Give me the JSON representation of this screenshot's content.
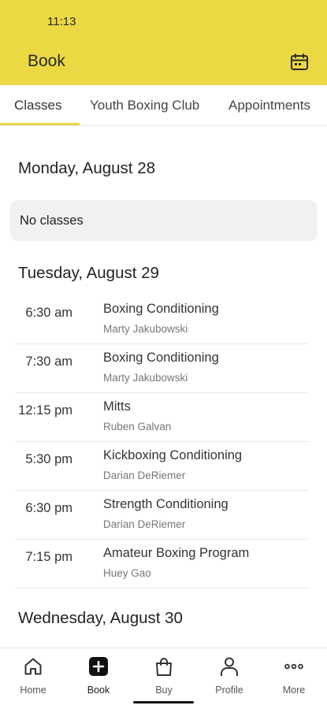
{
  "status_bar": {
    "time": "11:13"
  },
  "header": {
    "title": "Book",
    "calendar_icon": "calendar-icon",
    "background": "#ebd843"
  },
  "tabs": [
    {
      "label": "Classes",
      "active": true
    },
    {
      "label": "Youth Boxing Club",
      "active": false
    },
    {
      "label": "Appointments",
      "active": false
    }
  ],
  "days": [
    {
      "heading": "Monday, August 28",
      "empty_text": "No classes"
    },
    {
      "heading": "Tuesday, August 29",
      "classes": [
        {
          "time": "6:30 am",
          "name": "Boxing Conditioning",
          "instructor": "Marty Jakubowski"
        },
        {
          "time": "7:30 am",
          "name": "Boxing Conditioning",
          "instructor": "Marty Jakubowski"
        },
        {
          "time": "12:15 pm",
          "name": "Mitts",
          "instructor": "Ruben Galvan"
        },
        {
          "time": "5:30 pm",
          "name": "Kickboxing Conditioning",
          "instructor": "Darian DeRiemer"
        },
        {
          "time": "6:30 pm",
          "name": "Strength Conditioning",
          "instructor": "Darian DeRiemer"
        },
        {
          "time": "7:15 pm",
          "name": "Amateur Boxing Program",
          "instructor": "Huey Gao"
        }
      ]
    },
    {
      "heading": "Wednesday, August 30"
    }
  ],
  "bottom_nav": [
    {
      "label": "Home",
      "icon": "home-icon"
    },
    {
      "label": "Book",
      "icon": "plus-square-icon"
    },
    {
      "label": "Buy",
      "icon": "shopping-bag-icon"
    },
    {
      "label": "Profile",
      "icon": "person-icon"
    },
    {
      "label": "More",
      "icon": "more-dots-icon"
    }
  ]
}
